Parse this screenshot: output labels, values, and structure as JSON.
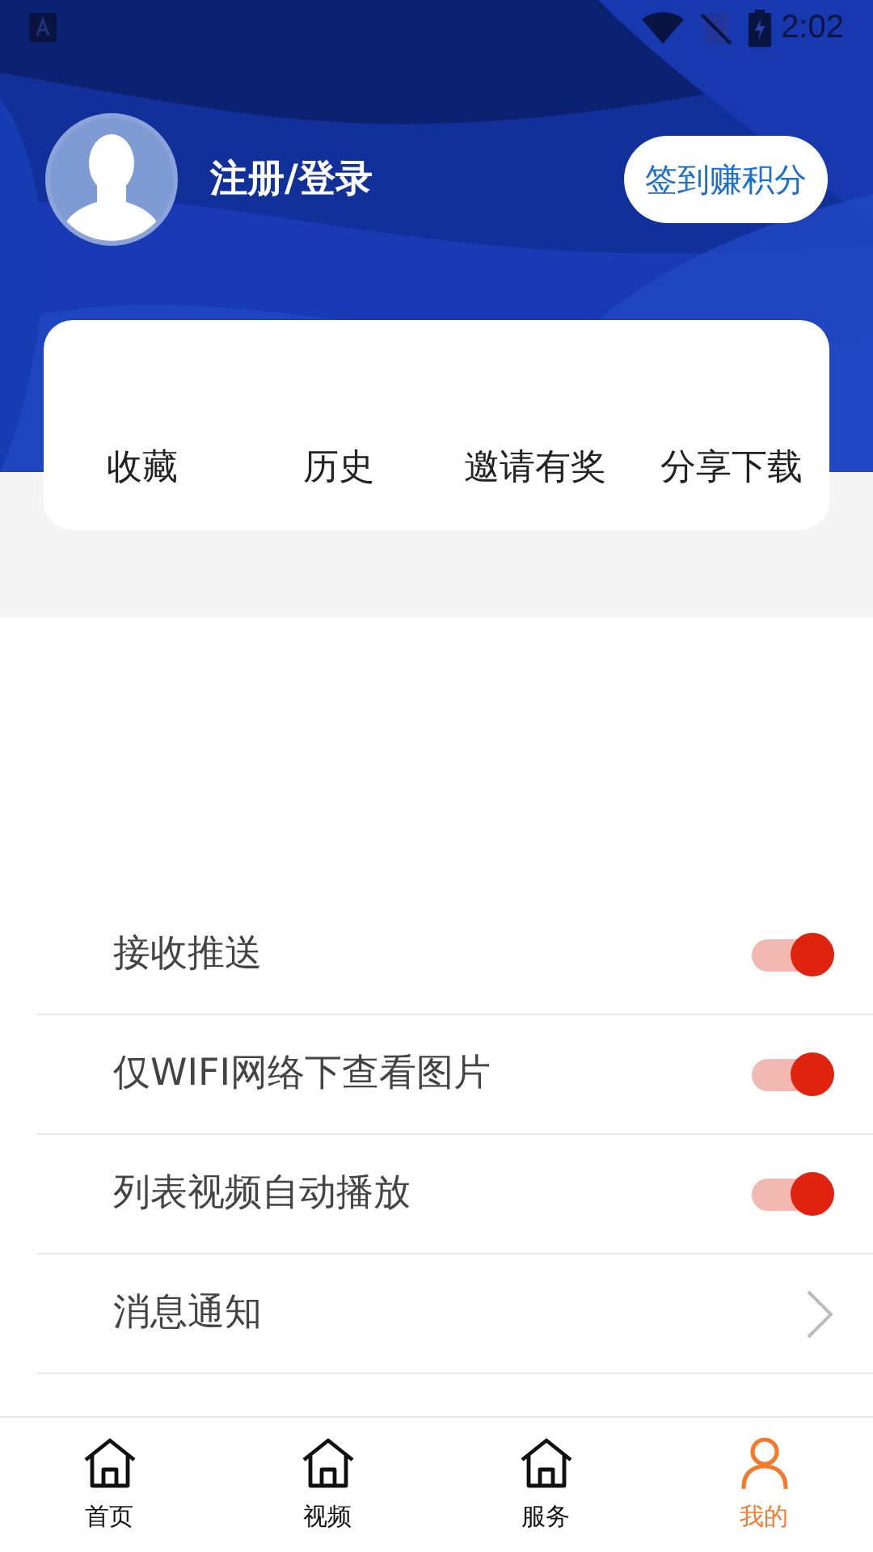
{
  "status_bar": {
    "time": "2:02"
  },
  "profile": {
    "login_label": "注册/登录",
    "checkin_button": "签到赚积分"
  },
  "quick_actions": [
    {
      "label": "收藏"
    },
    {
      "label": "历史"
    },
    {
      "label": "邀请有奖"
    },
    {
      "label": "分享下载"
    }
  ],
  "settings": [
    {
      "kind": "toggle",
      "label": "接收推送",
      "on": true
    },
    {
      "kind": "toggle",
      "label": "仅WIFI网络下查看图片",
      "on": true
    },
    {
      "kind": "toggle",
      "label": "列表视频自动播放",
      "on": true
    },
    {
      "kind": "link",
      "label": "消息通知"
    }
  ],
  "bottom_nav": [
    {
      "label": "首页",
      "kind": "home",
      "selected": false
    },
    {
      "label": "视频",
      "kind": "home",
      "selected": false
    },
    {
      "label": "服务",
      "kind": "home",
      "selected": false
    },
    {
      "label": "我的",
      "kind": "user",
      "selected": true
    }
  ]
}
